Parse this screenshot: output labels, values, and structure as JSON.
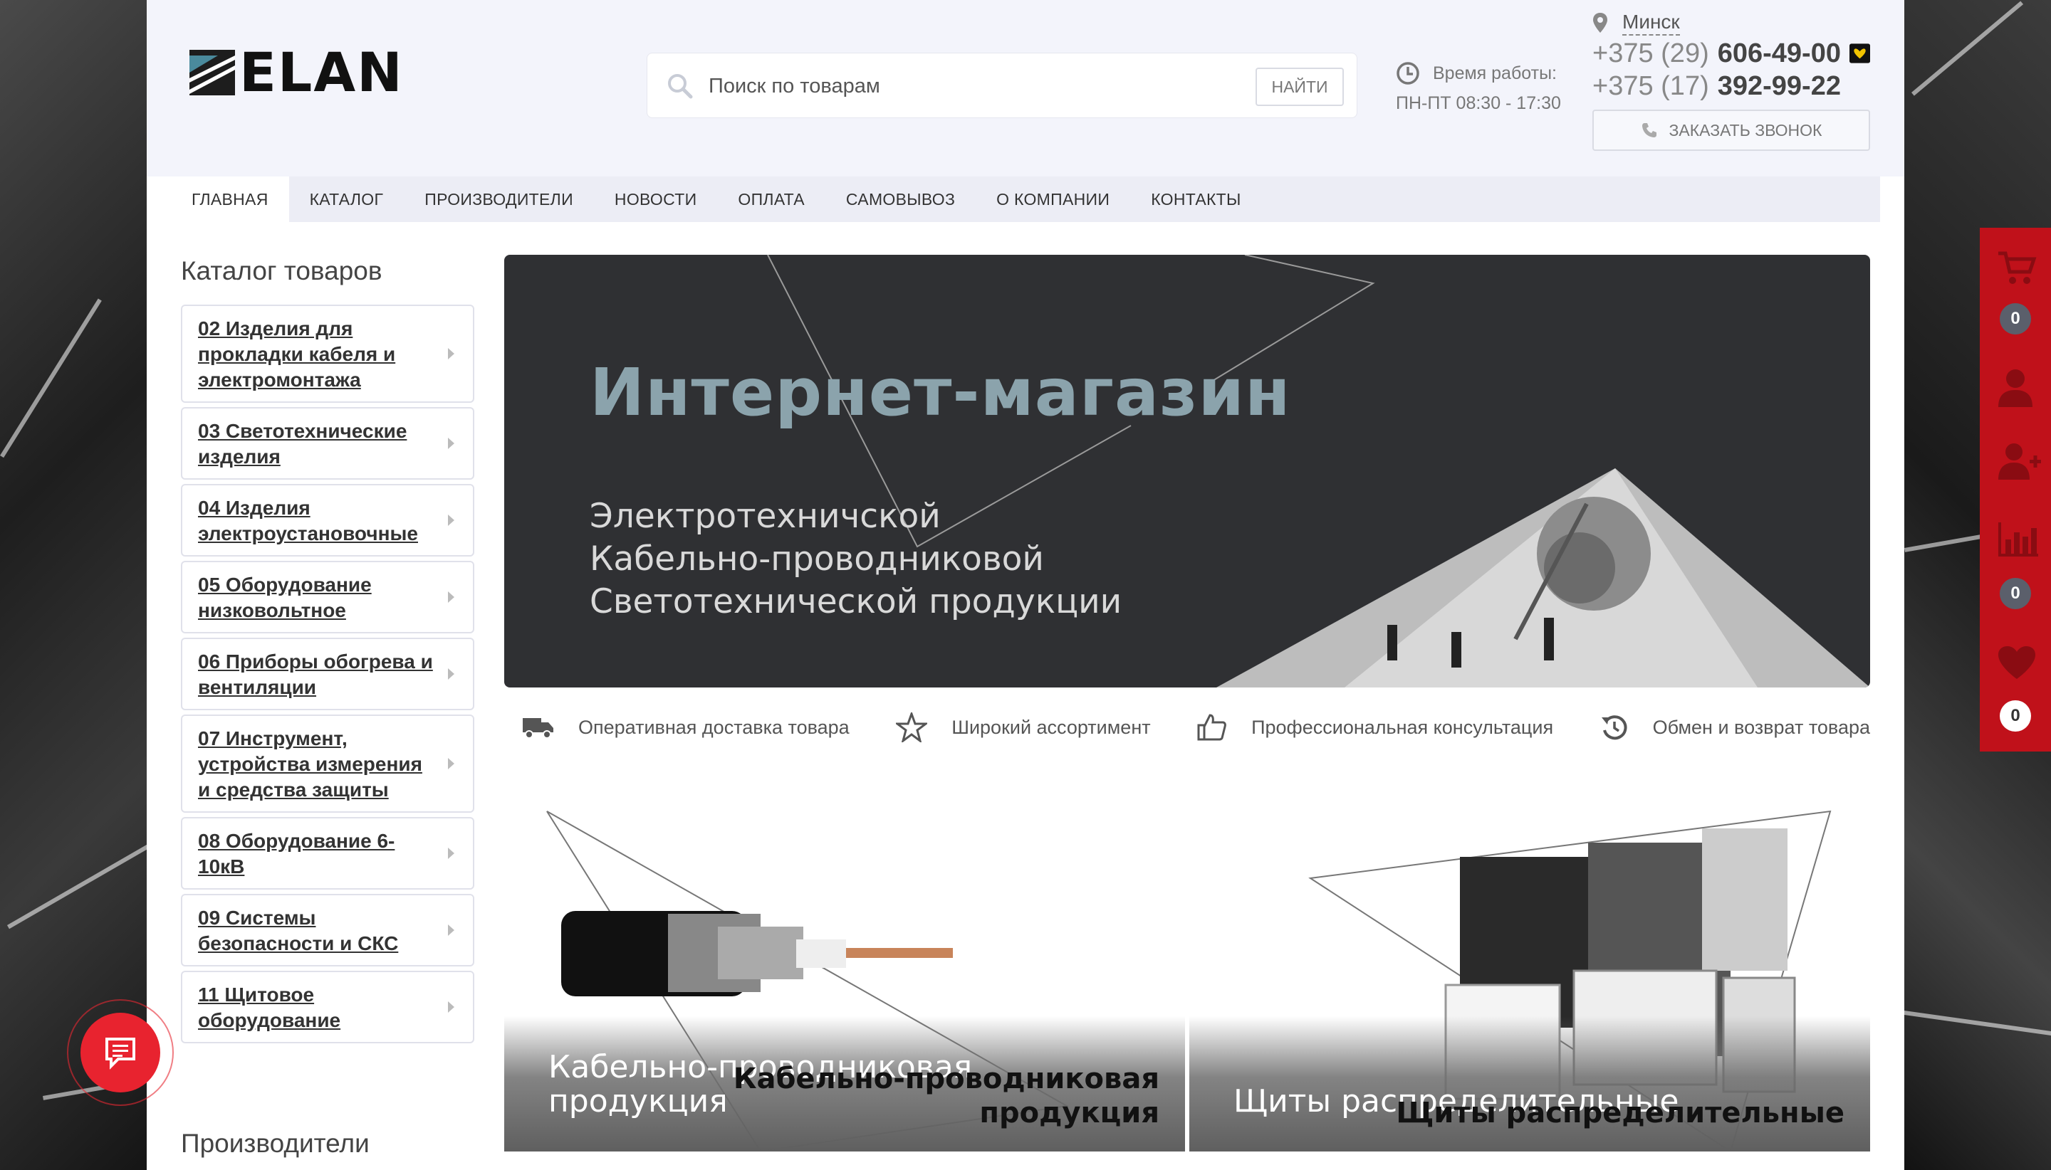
{
  "brand": {
    "name": "ELAN"
  },
  "search": {
    "placeholder": "Поиск по товарам",
    "button_label": "НАЙТИ"
  },
  "hours": {
    "label": "Время работы:",
    "value": "ПН-ПТ 08:30 - 17:30"
  },
  "contact": {
    "city": "Минск",
    "phones": [
      {
        "code": "+375 (29)",
        "number": "606-49-00"
      },
      {
        "code": "+375 (17)",
        "number": "392-99-22"
      }
    ],
    "callback_label": "ЗАКАЗАТЬ ЗВОНОК"
  },
  "nav": {
    "items": [
      "ГЛАВНАЯ",
      "КАТАЛОГ",
      "ПРОИЗВОДИТЕЛИ",
      "НОВОСТИ",
      "ОПЛАТА",
      "САМОВЫВОЗ",
      "О КОМПАНИИ",
      "КОНТАКТЫ"
    ],
    "active": "ГЛАВНАЯ"
  },
  "sidebar": {
    "catalog_title": "Каталог товаров",
    "categories": [
      "02 Изделия для прокладки кабеля и электромонтажа",
      "03 Светотехнические изделия",
      "04 Изделия электроустановочные",
      "05 Оборудование низковольтное",
      "06 Приборы обогрева и вентиляции",
      "07 Инструмент, устройства измерения и средства защиты",
      "08 Оборудование 6-10кВ",
      "09 Системы безопасности и СКС",
      "11 Щитовое оборудование"
    ],
    "producers_title": "Производители"
  },
  "hero": {
    "title": "Интернет-магазин",
    "subtitle_lines": [
      "Электротехничской",
      "Кабельно-проводниковой",
      "Светотехнической продукции"
    ]
  },
  "features": [
    {
      "icon": "truck-icon",
      "label": "Оперативная доставка товара"
    },
    {
      "icon": "star-icon",
      "label": "Широкий ассортимент"
    },
    {
      "icon": "thumbs-up-icon",
      "label": "Профессиональная консультация"
    },
    {
      "icon": "return-icon",
      "label": "Обмен и возврат товара"
    }
  ],
  "tiles": [
    {
      "caption_lines": [
        "Кабельно-проводниковая",
        "продукция"
      ]
    },
    {
      "caption_lines": [
        "Щиты распределительные"
      ]
    }
  ],
  "side_panel": {
    "cart_count": "0",
    "compare_count": "0",
    "favorites_count": "0"
  },
  "colors": {
    "accent_red": "#c0111a",
    "header_bg": "#f3f4fb",
    "nav_bg": "#ecedf5",
    "hero_title": "#8ba3ac"
  }
}
